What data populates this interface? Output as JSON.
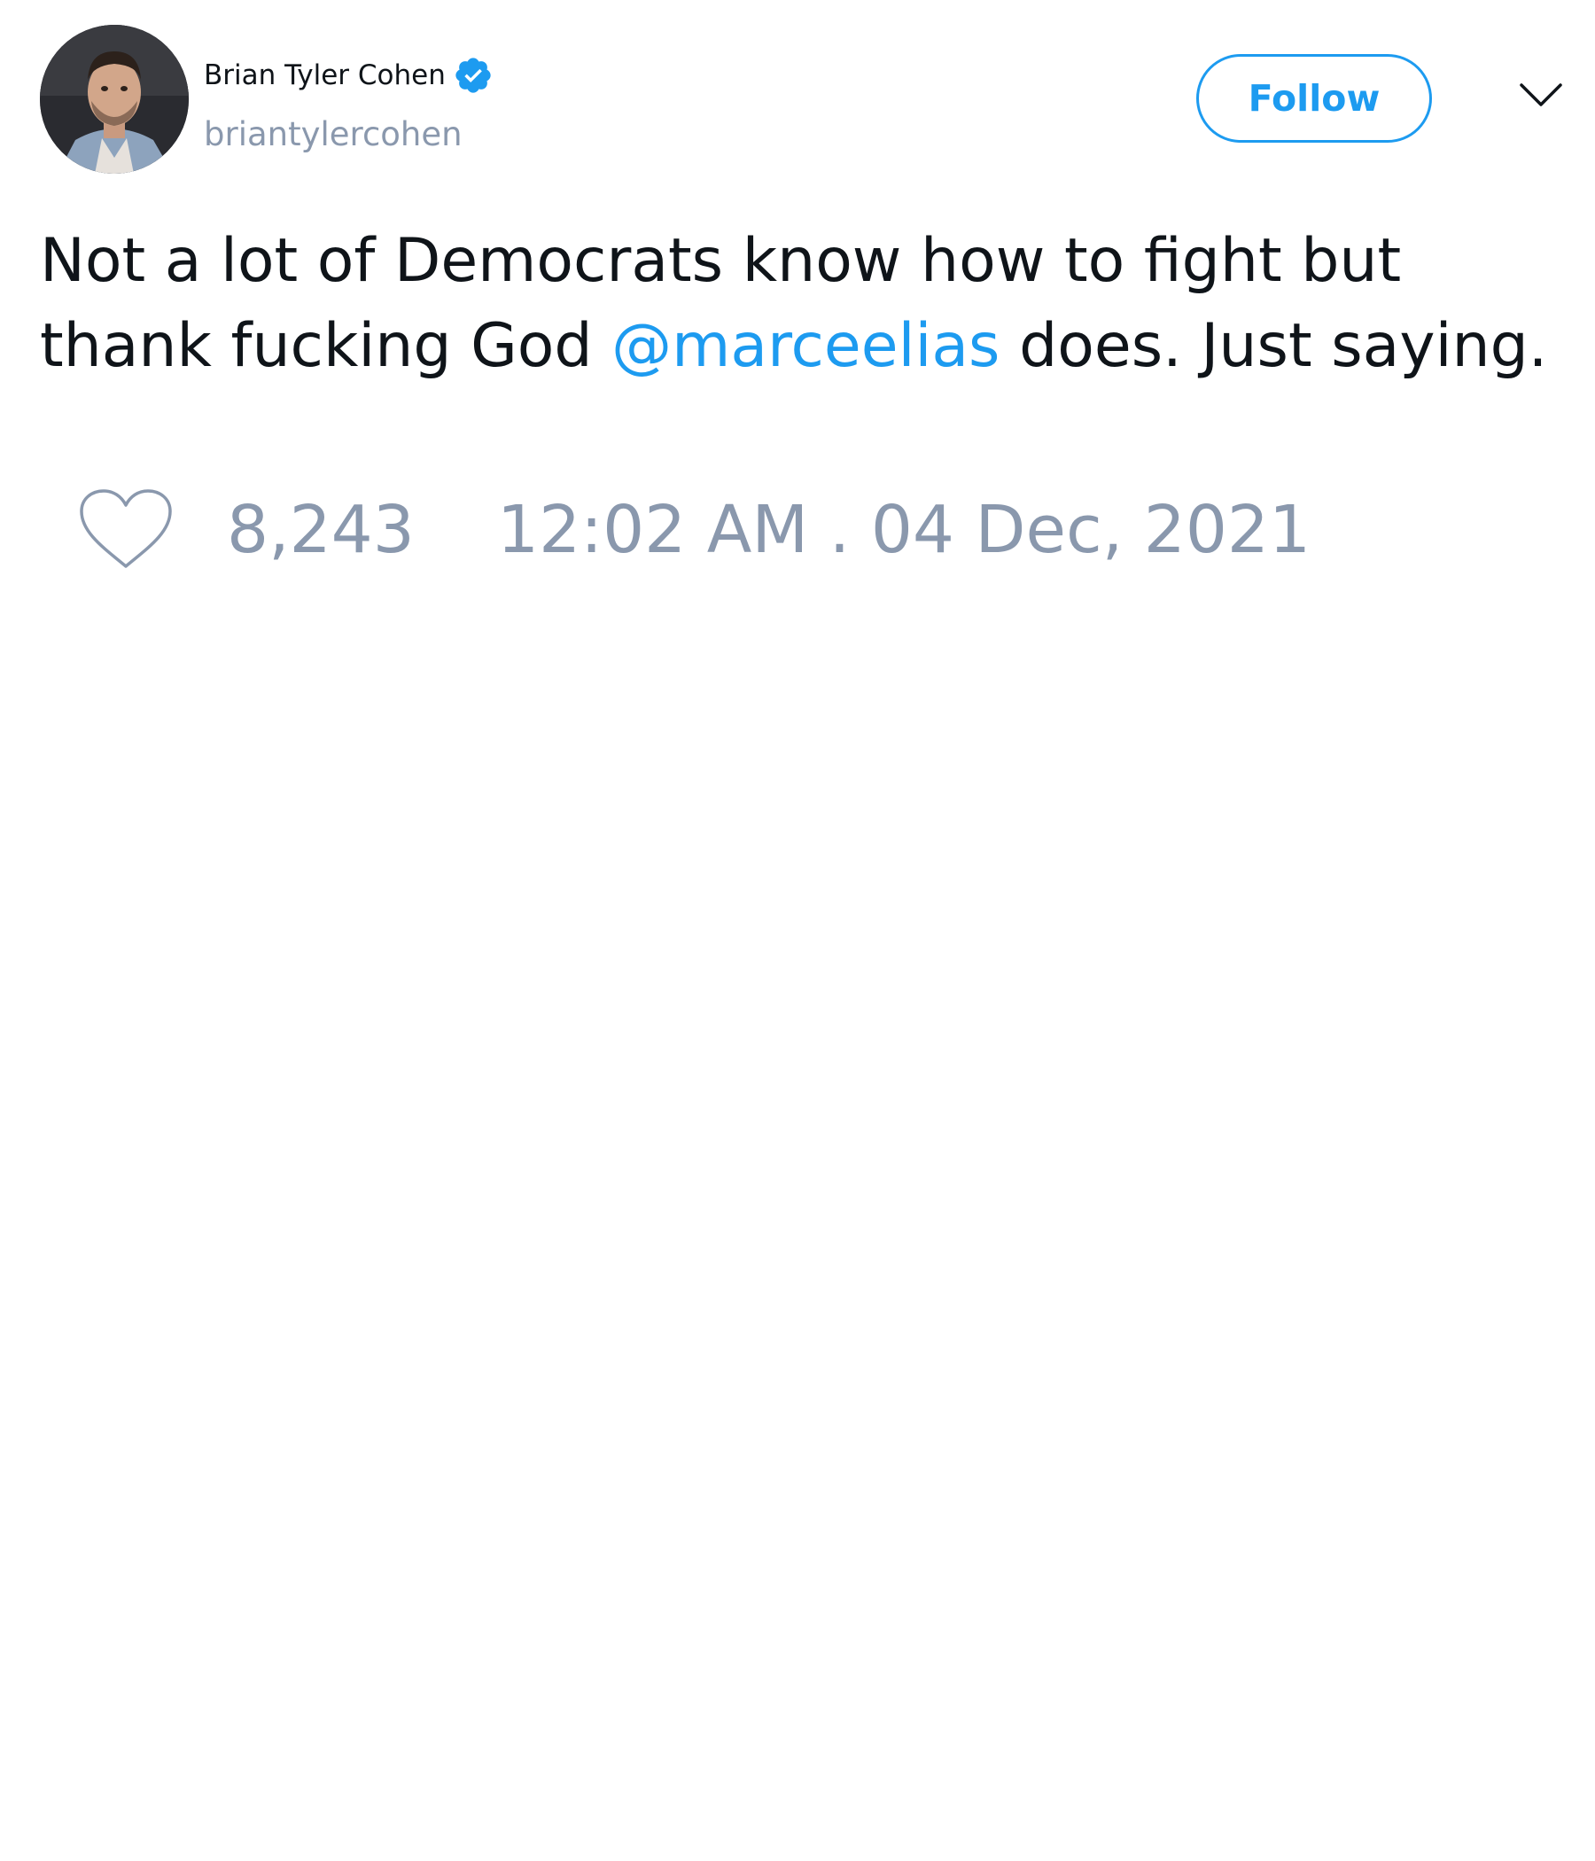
{
  "tweet": {
    "author": {
      "display_name": "Brian Tyler Cohen",
      "username": "briantylercohen",
      "verified": true,
      "verified_icon": "verified-badge-icon"
    },
    "follow_label": "Follow",
    "more_icon": "chevron-down-icon",
    "text": {
      "before_mention": "Not a lot of Democrats know how to fight but thank fucking God ",
      "mention": "@marceelias",
      "after_mention": " does. Just saying."
    },
    "like_icon": "heart-icon",
    "like_count": "8,243",
    "timestamp": "12:02 AM . 04 Dec, 2021"
  },
  "colors": {
    "accent": "#1d9bf0",
    "muted_text": "#8a98ad",
    "primary_text": "#0f1419",
    "background": "#ffffff"
  }
}
